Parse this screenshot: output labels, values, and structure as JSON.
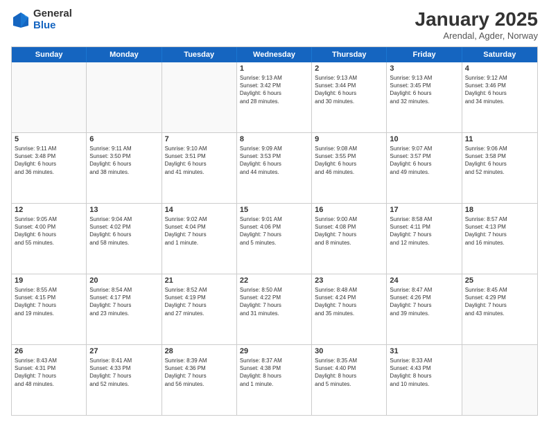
{
  "logo": {
    "general": "General",
    "blue": "Blue"
  },
  "title": "January 2025",
  "subtitle": "Arendal, Agder, Norway",
  "dayHeaders": [
    "Sunday",
    "Monday",
    "Tuesday",
    "Wednesday",
    "Thursday",
    "Friday",
    "Saturday"
  ],
  "weeks": [
    [
      {
        "day": "",
        "info": ""
      },
      {
        "day": "",
        "info": ""
      },
      {
        "day": "",
        "info": ""
      },
      {
        "day": "1",
        "info": "Sunrise: 9:13 AM\nSunset: 3:42 PM\nDaylight: 6 hours\nand 28 minutes."
      },
      {
        "day": "2",
        "info": "Sunrise: 9:13 AM\nSunset: 3:44 PM\nDaylight: 6 hours\nand 30 minutes."
      },
      {
        "day": "3",
        "info": "Sunrise: 9:13 AM\nSunset: 3:45 PM\nDaylight: 6 hours\nand 32 minutes."
      },
      {
        "day": "4",
        "info": "Sunrise: 9:12 AM\nSunset: 3:46 PM\nDaylight: 6 hours\nand 34 minutes."
      }
    ],
    [
      {
        "day": "5",
        "info": "Sunrise: 9:11 AM\nSunset: 3:48 PM\nDaylight: 6 hours\nand 36 minutes."
      },
      {
        "day": "6",
        "info": "Sunrise: 9:11 AM\nSunset: 3:50 PM\nDaylight: 6 hours\nand 38 minutes."
      },
      {
        "day": "7",
        "info": "Sunrise: 9:10 AM\nSunset: 3:51 PM\nDaylight: 6 hours\nand 41 minutes."
      },
      {
        "day": "8",
        "info": "Sunrise: 9:09 AM\nSunset: 3:53 PM\nDaylight: 6 hours\nand 44 minutes."
      },
      {
        "day": "9",
        "info": "Sunrise: 9:08 AM\nSunset: 3:55 PM\nDaylight: 6 hours\nand 46 minutes."
      },
      {
        "day": "10",
        "info": "Sunrise: 9:07 AM\nSunset: 3:57 PM\nDaylight: 6 hours\nand 49 minutes."
      },
      {
        "day": "11",
        "info": "Sunrise: 9:06 AM\nSunset: 3:58 PM\nDaylight: 6 hours\nand 52 minutes."
      }
    ],
    [
      {
        "day": "12",
        "info": "Sunrise: 9:05 AM\nSunset: 4:00 PM\nDaylight: 6 hours\nand 55 minutes."
      },
      {
        "day": "13",
        "info": "Sunrise: 9:04 AM\nSunset: 4:02 PM\nDaylight: 6 hours\nand 58 minutes."
      },
      {
        "day": "14",
        "info": "Sunrise: 9:02 AM\nSunset: 4:04 PM\nDaylight: 7 hours\nand 1 minute."
      },
      {
        "day": "15",
        "info": "Sunrise: 9:01 AM\nSunset: 4:06 PM\nDaylight: 7 hours\nand 5 minutes."
      },
      {
        "day": "16",
        "info": "Sunrise: 9:00 AM\nSunset: 4:08 PM\nDaylight: 7 hours\nand 8 minutes."
      },
      {
        "day": "17",
        "info": "Sunrise: 8:58 AM\nSunset: 4:11 PM\nDaylight: 7 hours\nand 12 minutes."
      },
      {
        "day": "18",
        "info": "Sunrise: 8:57 AM\nSunset: 4:13 PM\nDaylight: 7 hours\nand 16 minutes."
      }
    ],
    [
      {
        "day": "19",
        "info": "Sunrise: 8:55 AM\nSunset: 4:15 PM\nDaylight: 7 hours\nand 19 minutes."
      },
      {
        "day": "20",
        "info": "Sunrise: 8:54 AM\nSunset: 4:17 PM\nDaylight: 7 hours\nand 23 minutes."
      },
      {
        "day": "21",
        "info": "Sunrise: 8:52 AM\nSunset: 4:19 PM\nDaylight: 7 hours\nand 27 minutes."
      },
      {
        "day": "22",
        "info": "Sunrise: 8:50 AM\nSunset: 4:22 PM\nDaylight: 7 hours\nand 31 minutes."
      },
      {
        "day": "23",
        "info": "Sunrise: 8:48 AM\nSunset: 4:24 PM\nDaylight: 7 hours\nand 35 minutes."
      },
      {
        "day": "24",
        "info": "Sunrise: 8:47 AM\nSunset: 4:26 PM\nDaylight: 7 hours\nand 39 minutes."
      },
      {
        "day": "25",
        "info": "Sunrise: 8:45 AM\nSunset: 4:29 PM\nDaylight: 7 hours\nand 43 minutes."
      }
    ],
    [
      {
        "day": "26",
        "info": "Sunrise: 8:43 AM\nSunset: 4:31 PM\nDaylight: 7 hours\nand 48 minutes."
      },
      {
        "day": "27",
        "info": "Sunrise: 8:41 AM\nSunset: 4:33 PM\nDaylight: 7 hours\nand 52 minutes."
      },
      {
        "day": "28",
        "info": "Sunrise: 8:39 AM\nSunset: 4:36 PM\nDaylight: 7 hours\nand 56 minutes."
      },
      {
        "day": "29",
        "info": "Sunrise: 8:37 AM\nSunset: 4:38 PM\nDaylight: 8 hours\nand 1 minute."
      },
      {
        "day": "30",
        "info": "Sunrise: 8:35 AM\nSunset: 4:40 PM\nDaylight: 8 hours\nand 5 minutes."
      },
      {
        "day": "31",
        "info": "Sunrise: 8:33 AM\nSunset: 4:43 PM\nDaylight: 8 hours\nand 10 minutes."
      },
      {
        "day": "",
        "info": ""
      }
    ]
  ]
}
